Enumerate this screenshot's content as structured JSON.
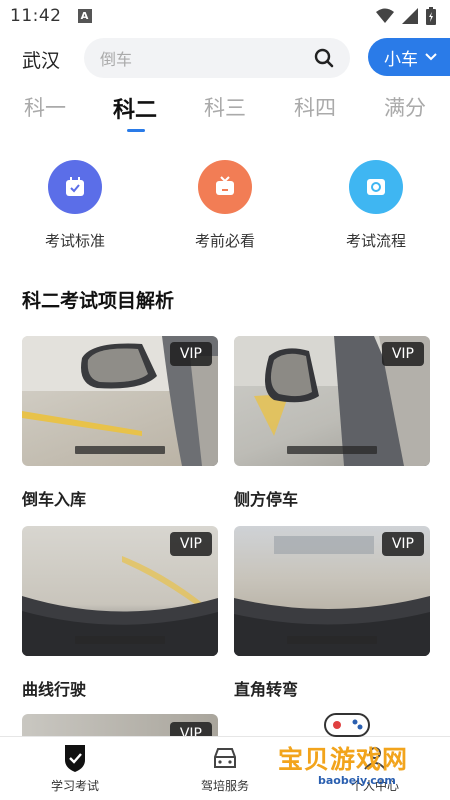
{
  "status_bar": {
    "time": "11:42",
    "a_icon": "A"
  },
  "header": {
    "city": "武汉",
    "search_placeholder": "倒车",
    "car_type": "小车"
  },
  "tabs": [
    {
      "label": "科一"
    },
    {
      "label": "科二",
      "active": true
    },
    {
      "label": "科三"
    },
    {
      "label": "科四"
    },
    {
      "label": "满分"
    }
  ],
  "quick_entries": [
    {
      "label": "考试标准",
      "icon": "checklist-icon",
      "color": "#5b6ee8"
    },
    {
      "label": "考前必看",
      "icon": "video-icon",
      "color": "#f27d55"
    },
    {
      "label": "考试流程",
      "icon": "flow-icon",
      "color": "#3fb6f2"
    }
  ],
  "section": {
    "title": "科二考试项目解析",
    "cards": [
      {
        "title": "倒车入库",
        "badge": "VIP"
      },
      {
        "title": "侧方停车",
        "badge": "VIP"
      },
      {
        "title": "曲线行驶",
        "badge": "VIP"
      },
      {
        "title": "直角转弯",
        "badge": "VIP"
      },
      {
        "title": "",
        "badge": "VIP"
      }
    ]
  },
  "bottom_nav": [
    {
      "label": "学习考试",
      "icon": "shield-check-icon",
      "active": true
    },
    {
      "label": "驾培服务",
      "icon": "car-icon"
    },
    {
      "label": "个人中心",
      "icon": "user-icon"
    }
  ],
  "watermark": {
    "text": "宝贝游戏网",
    "sub": "baobeiy.com"
  },
  "colors": {
    "accent": "#2a7be8"
  }
}
